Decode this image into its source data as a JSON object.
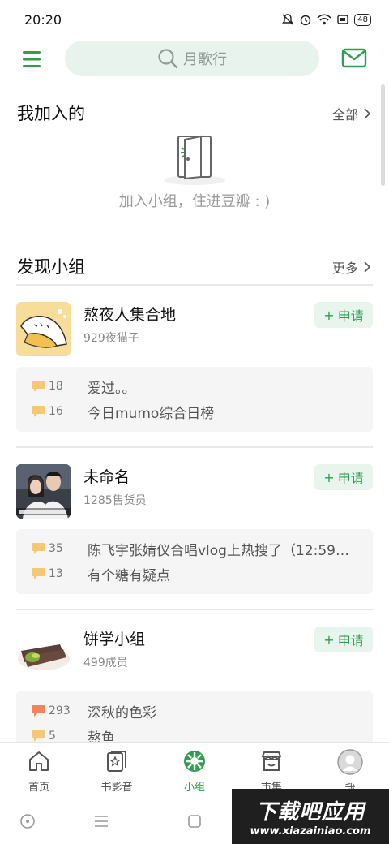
{
  "status_bar": {
    "time": "20:20",
    "battery": "48"
  },
  "search": {
    "placeholder": "月歌行"
  },
  "joined": {
    "title": "我加入的",
    "link": "全部",
    "empty_text": "加入小组，住进豆瓣 : )"
  },
  "discover": {
    "title": "发现小组",
    "link": "更多"
  },
  "join_label": "申请",
  "groups": [
    {
      "name": "熬夜人集合地",
      "members": "929夜猫子",
      "topics": [
        {
          "count": "18",
          "title": "爱过。。",
          "hot": false
        },
        {
          "count": "16",
          "title": "今日mumo综合日榜",
          "hot": false
        }
      ]
    },
    {
      "name": "未命名",
      "members": "1285售货员",
      "topics": [
        {
          "count": "35",
          "title": "陈飞宇张婧仪合唱vlog上热搜了（12:59总...",
          "hot": false
        },
        {
          "count": "13",
          "title": "有个糖有疑点",
          "hot": false
        }
      ]
    },
    {
      "name": "饼学小组",
      "members": "499成员",
      "topics": [
        {
          "count": "293",
          "title": "深秋的色彩",
          "hot": true
        },
        {
          "count": "5",
          "title": "熬鱼",
          "hot": false
        }
      ]
    }
  ],
  "tabs": [
    {
      "label": "首页",
      "icon": "home-icon",
      "active": false
    },
    {
      "label": "书影音",
      "icon": "book-film-music-icon",
      "active": false
    },
    {
      "label": "小组",
      "icon": "group-icon",
      "active": true
    },
    {
      "label": "市集",
      "icon": "market-icon",
      "active": false
    },
    {
      "label": "我",
      "icon": "avatar-icon",
      "active": false
    }
  ],
  "watermark": {
    "title": "下载吧应用",
    "url": "www.xiazainiao.com"
  },
  "colors": {
    "brand_green": "#2e9e4f",
    "join_bg": "#e7f5ec",
    "comment_yellow": "#f7c873",
    "comment_orange": "#f0845c"
  }
}
